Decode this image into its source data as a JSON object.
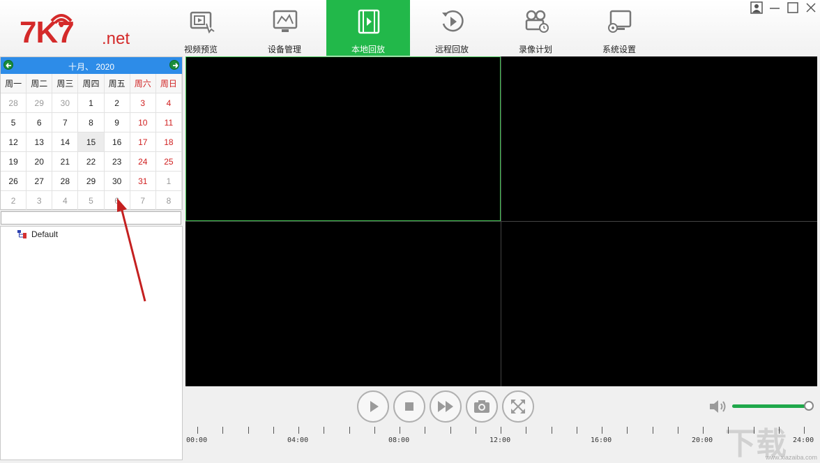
{
  "logo": {
    "main": "7K7",
    "suffix": ".net"
  },
  "tabs": [
    {
      "label": "视频预览",
      "icon": "video-preview-icon",
      "active": false
    },
    {
      "label": "设备管理",
      "icon": "device-manage-icon",
      "active": false
    },
    {
      "label": "本地回放",
      "icon": "film-strip-icon",
      "active": true
    },
    {
      "label": "远程回放",
      "icon": "remote-replay-icon",
      "active": false
    },
    {
      "label": "录像计划",
      "icon": "camera-schedule-icon",
      "active": false
    },
    {
      "label": "系统设置",
      "icon": "system-settings-icon",
      "active": false
    }
  ],
  "calendar": {
    "title": "十月、 2020",
    "weekdays": [
      "周一",
      "周二",
      "周三",
      "周四",
      "周五",
      "周六",
      "周日"
    ],
    "weeks": [
      [
        "28",
        "29",
        "30",
        "1",
        "2",
        "3",
        "4"
      ],
      [
        "5",
        "6",
        "7",
        "8",
        "9",
        "10",
        "11"
      ],
      [
        "12",
        "13",
        "14",
        "15",
        "16",
        "17",
        "18"
      ],
      [
        "19",
        "20",
        "21",
        "22",
        "23",
        "24",
        "25"
      ],
      [
        "26",
        "27",
        "28",
        "29",
        "30",
        "31",
        "1"
      ],
      [
        "2",
        "3",
        "4",
        "5",
        "6",
        "7",
        "8"
      ]
    ],
    "today": "15"
  },
  "tree": {
    "root": "Default"
  },
  "volume": {
    "level": 0.98
  },
  "timeline": {
    "labels": [
      "00:00",
      "04:00",
      "08:00",
      "12:00",
      "16:00",
      "20:00",
      "24:00"
    ]
  },
  "watermark": {
    "text": "下载",
    "url": "www.xiazaiba.com"
  },
  "colors": {
    "accent": "#22b84a",
    "calendar_header": "#2d8ce8",
    "weekend": "#d02020"
  }
}
